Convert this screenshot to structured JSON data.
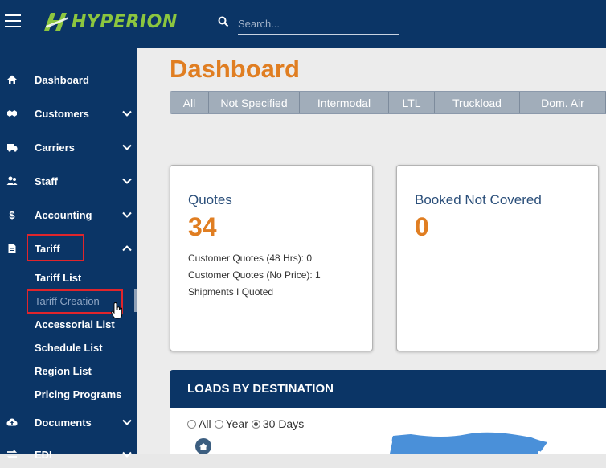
{
  "app": {
    "brand": "HYPERION",
    "brand_color": "#8cc63f",
    "nav_bg": "#0b3566"
  },
  "search": {
    "placeholder": "Search..."
  },
  "sidebar": {
    "items": [
      {
        "label": "Dashboard",
        "icon": "home-icon"
      },
      {
        "label": "Customers",
        "icon": "handshake-icon"
      },
      {
        "label": "Carriers",
        "icon": "truck-icon"
      },
      {
        "label": "Staff",
        "icon": "users-icon"
      },
      {
        "label": "Accounting",
        "icon": "dollar-icon"
      },
      {
        "label": "Tariff",
        "icon": "document-icon",
        "expanded": true
      },
      {
        "label": "Documents",
        "icon": "cloud-upload-icon"
      },
      {
        "label": "EDI",
        "icon": "exchange-icon"
      }
    ],
    "tariff_sub": [
      {
        "label": "Tariff List"
      },
      {
        "label": "Tariff Creation",
        "active": true
      },
      {
        "label": "Accessorial List"
      },
      {
        "label": "Schedule List"
      },
      {
        "label": "Region List"
      },
      {
        "label": "Pricing Programs"
      }
    ]
  },
  "page": {
    "title": "Dashboard",
    "title_color": "#e07e22"
  },
  "filters": [
    "All",
    "Not Specified",
    "Intermodal",
    "LTL",
    "Truckload",
    "Dom. Air"
  ],
  "cards": {
    "quotes": {
      "title": "Quotes",
      "value": "34",
      "lines": [
        "Customer Quotes (48 Hrs): 0",
        "Customer Quotes (No Price): 1",
        "Shipments I Quoted"
      ]
    },
    "booked": {
      "title": "Booked Not Covered",
      "value": "0"
    }
  },
  "loads_panel": {
    "title": "LOADS BY DESTINATION",
    "ranges": [
      {
        "label": "All",
        "checked": false
      },
      {
        "label": "Year",
        "checked": false
      },
      {
        "label": "30 Days",
        "checked": true
      }
    ]
  }
}
